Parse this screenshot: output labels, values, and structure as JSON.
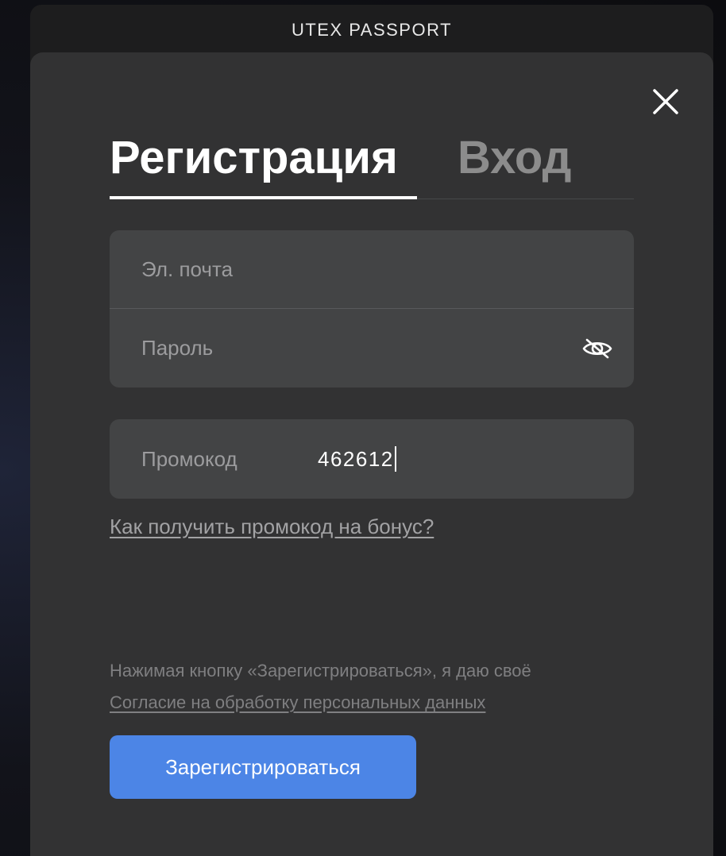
{
  "header": {
    "title": "UTEX PASSPORT"
  },
  "tabs": [
    {
      "label": "Регистрация",
      "active": true
    },
    {
      "label": "Вход",
      "active": false
    }
  ],
  "form": {
    "email_placeholder": "Эл. почта",
    "email_value": "",
    "password_placeholder": "Пароль",
    "password_value": "",
    "promo_label": "Промокод",
    "promo_value": "462612",
    "promo_help_link": "Как получить промокод на бонус?"
  },
  "consent": {
    "text": "Нажимая кнопку «Зарегистрироваться», я даю своё",
    "link": "Согласие на обработку персональных данных"
  },
  "submit_label": "Зарегистрироваться",
  "icons": {
    "close": "close-icon",
    "password_visibility": "eye-off-icon"
  },
  "colors": {
    "accent": "#4c85e6",
    "card_bg": "#323233",
    "field_bg": "#434445"
  }
}
